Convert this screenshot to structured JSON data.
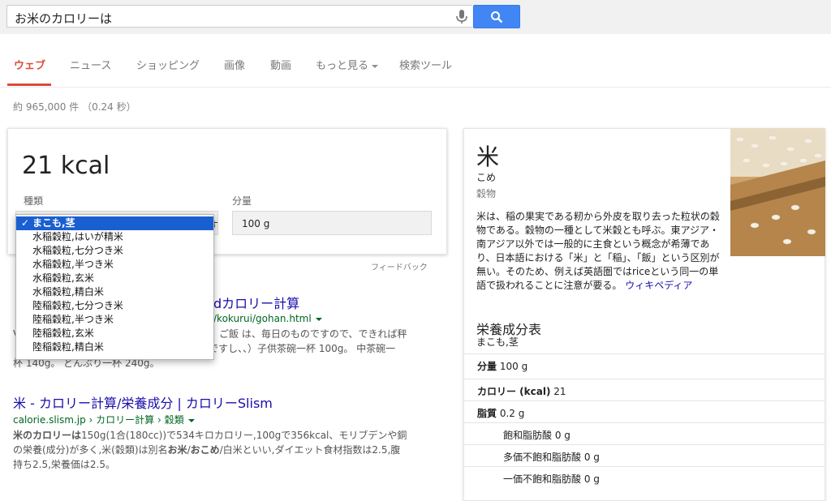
{
  "search": {
    "query": "お米のカロリーは"
  },
  "tabs": [
    {
      "label": "ウェブ",
      "active": true
    },
    {
      "label": "ニュース"
    },
    {
      "label": "ショッピング"
    },
    {
      "label": "画像"
    },
    {
      "label": "動画"
    },
    {
      "label": "もっと見る"
    },
    {
      "label": "検索ツール"
    }
  ],
  "result_stats": "約 965,000 件 （0.24 秒）",
  "calorie_card": {
    "value": "21 kcal",
    "type_label": "種類",
    "amount_label": "分量",
    "amount_value": "100 g",
    "type_value_tail": "す",
    "feedback": "フィードバック",
    "type_options": [
      "まこも,茎",
      "水稲穀粒,はいが精米",
      "水稲穀粒,七分つき米",
      "水稲穀粒,半つき米",
      "水稲穀粒,玄米",
      "水稲穀粒,精白米",
      "陸稲穀粒,七分つき米",
      "陸稲穀粒,半つき米",
      "陸稲穀粒,玄米",
      "陸稲穀粒,精白米"
    ],
    "selected_index": 0,
    "check": "✓"
  },
  "results": [
    {
      "title_tail": "dカロリー計算",
      "url_tail": "/kokurui/gohan.html",
      "snippet_line1_a": "V",
      "snippet_line1_b": "ご飯 は、毎日のものですので、できれば秤",
      "snippet_line2_a": "ですし、、）子供茶碗一杯 100g。 中茶碗一",
      "snippet_line3": "杯 140g。 どんぶり一杯 240g。"
    },
    {
      "title": "米 - カロリー計算/栄養成分 | カロリーSlism",
      "url": "calorie.slism.jp › カロリー計算 › 穀類",
      "snippet_l1_bold": "米のカロリーは",
      "snippet_l1_rest": "150g(1合(180cc))で534キロカロリー,100gで356kcal、モリブデンや銅",
      "snippet_l2_a": "の栄養(成分)が多く,米(穀類)は別名",
      "snippet_l2_bold1": "お米",
      "snippet_l2_sep": "/",
      "snippet_l2_bold2": "おこめ",
      "snippet_l2_rest": "/白米といい,ダイエット食材指数は2.5,腹",
      "snippet_l3": "持ち2.5,栄養価は2.5。"
    }
  ],
  "knowledge_panel": {
    "title": "米",
    "reading": "こめ",
    "category": "穀物",
    "description": "米は、稲の果実である籾から外皮を取り去った粒状の穀物である。穀物の一種として米穀とも呼ぶ。東アジア・南アジア以外では一般的に主食という概念が希薄であり、日本語における「米」と「稲」、「飯」という区別が無い。そのため、例えば英語圏ではriceという同一の単語で扱われることに注意が要る。",
    "wiki_link": "ウィキペディア",
    "nutrition_title": "栄養成分表",
    "nutrition_subtitle": "まこも,茎",
    "rows": [
      {
        "label": "分量",
        "value": "100 g",
        "bold": true,
        "indent": false
      },
      {
        "label": "カロリー (kcal)",
        "value": "21",
        "bold": true,
        "indent": false
      },
      {
        "label": "脂質",
        "value": "0.2 g",
        "bold": true,
        "indent": false
      },
      {
        "label": "飽和脂肪酸",
        "value": "0 g",
        "bold": false,
        "indent": true
      },
      {
        "label": "多価不飽和脂肪酸",
        "value": "0 g",
        "bold": false,
        "indent": true
      },
      {
        "label": "一価不飽和脂肪酸",
        "value": "0 g",
        "bold": false,
        "indent": true
      }
    ]
  },
  "colors": {
    "accent": "#dd4b39",
    "link": "#1a0dab",
    "url": "#006621",
    "search_button": "#4285f4",
    "dropdown_selected": "#1a5fd1"
  },
  "icons": [
    "mic-icon",
    "search-icon",
    "check-icon",
    "chevron-down-icon"
  ]
}
